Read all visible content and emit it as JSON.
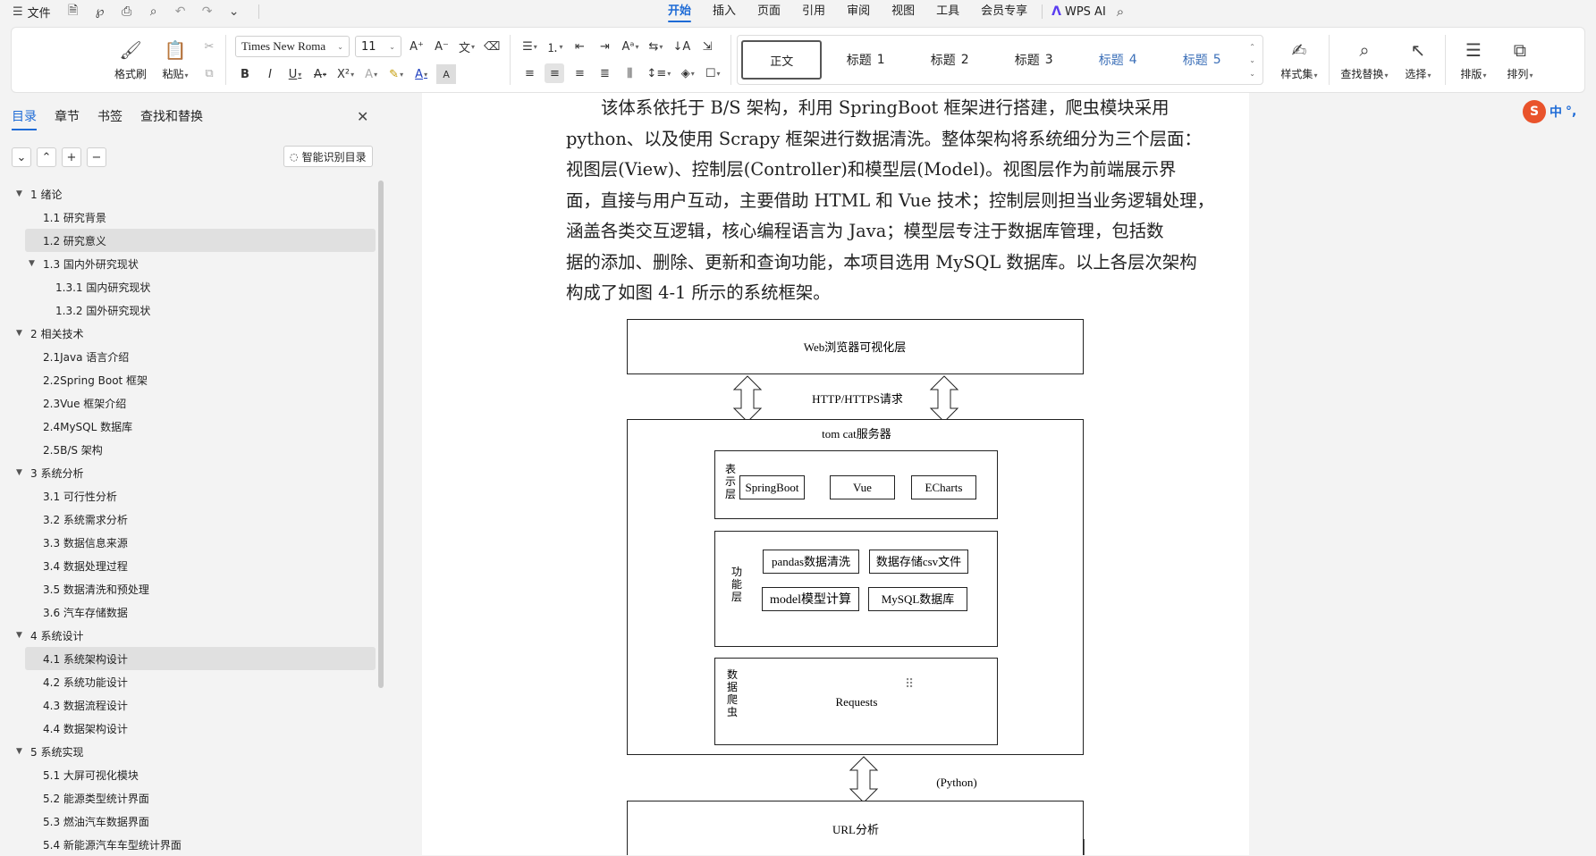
{
  "menubar": {
    "file_label": "文件",
    "tabs": [
      {
        "label": "开始",
        "active": true
      },
      {
        "label": "插入"
      },
      {
        "label": "页面"
      },
      {
        "label": "引用"
      },
      {
        "label": "审阅"
      },
      {
        "label": "视图"
      },
      {
        "label": "工具"
      },
      {
        "label": "会员专享"
      }
    ],
    "wps_ai_label": "WPS AI"
  },
  "ribbon": {
    "format_painter": "格式刷",
    "paste": "粘贴",
    "font_name": "Times New Roma",
    "font_size": "11",
    "styles": [
      {
        "label": "正文",
        "selected": true
      },
      {
        "label": "标题",
        "num": "1"
      },
      {
        "label": "标题",
        "num": "2"
      },
      {
        "label": "标题",
        "num": "3"
      },
      {
        "label": "标题",
        "num": "4",
        "blue": true
      },
      {
        "label": "标题",
        "num": "5",
        "blue": true
      }
    ],
    "style_set": "样式集",
    "find_replace": "查找替换",
    "select": "选择",
    "layout": "排版",
    "arrange": "排列"
  },
  "panel": {
    "tabs": [
      {
        "label": "目录",
        "active": true
      },
      {
        "label": "章节"
      },
      {
        "label": "书签"
      },
      {
        "label": "查找和替换"
      }
    ],
    "smart_toc": "智能识别目录",
    "toc": [
      {
        "label": "1 绪论",
        "level": 1,
        "expanded": true
      },
      {
        "label": "1.1 研究背景",
        "level": 2
      },
      {
        "label": "1.2 研究意义",
        "level": 2,
        "selected": true
      },
      {
        "label": "1.3 国内外研究现状",
        "level": 2,
        "expanded": true
      },
      {
        "label": "1.3.1 国内研究现状",
        "level": 3
      },
      {
        "label": "1.3.2 国外研究现状",
        "level": 3
      },
      {
        "label": "2 相关技术",
        "level": 1,
        "expanded": true
      },
      {
        "label": "2.1Java 语言介绍",
        "level": 2
      },
      {
        "label": "2.2Spring Boot 框架",
        "level": 2
      },
      {
        "label": "2.3Vue 框架介绍",
        "level": 2
      },
      {
        "label": "2.4MySQL 数据库",
        "level": 2
      },
      {
        "label": "2.5B/S 架构",
        "level": 2
      },
      {
        "label": "3 系统分析",
        "level": 1,
        "expanded": true
      },
      {
        "label": "3.1 可行性分析",
        "level": 2
      },
      {
        "label": "3.2 系统需求分析",
        "level": 2
      },
      {
        "label": "3.3 数据信息来源",
        "level": 2
      },
      {
        "label": "3.4 数据处理过程",
        "level": 2
      },
      {
        "label": "3.5 数据清洗和预处理",
        "level": 2
      },
      {
        "label": "3.6 汽车存储数据",
        "level": 2
      },
      {
        "label": "4 系统设计",
        "level": 1,
        "expanded": true
      },
      {
        "label": "4.1 系统架构设计",
        "level": 2,
        "selected": true
      },
      {
        "label": "4.2 系统功能设计",
        "level": 2
      },
      {
        "label": "4.3 数据流程设计",
        "level": 2
      },
      {
        "label": "4.4 数据架构设计",
        "level": 2
      },
      {
        "label": "5 系统实现",
        "level": 1,
        "expanded": true
      },
      {
        "label": "5.1  大屏可视化模块",
        "level": 2
      },
      {
        "label": "5.2 能源类型统计界面",
        "level": 2
      },
      {
        "label": "5.3 燃油汽车数据界面",
        "level": 2
      },
      {
        "label": "5.4 新能源汽车车型统计界面",
        "level": 2
      }
    ]
  },
  "doc": {
    "paragraph_lines": [
      "该体系依托于 B/S 架构，利用 SpringBoot 框架进行搭建，爬虫模块采用",
      "python、以及使用 Scrapy 框架进行数据清洗。整体架构将系统细分为三个层面：",
      "视图层(View)、控制层(Controller)和模型层(Model)。视图层作为前端展示界",
      "面，直接与用户互动，主要借助 HTML 和 Vue 技术；控制层则担当业务逻辑处理，",
      "涵盖各类交互逻辑，核心编程语言为 Java；模型层专注于数据库管理，包括数",
      "据的添加、删除、更新和查询功能，本项目选用 MySQL 数据库。以上各层次架构",
      "构成了如图 4-1 所示的系统框架。"
    ],
    "diagram": {
      "browser_layer": "Web浏览器可视化层",
      "http_label": "HTTP/HTTPS请求",
      "server_title": "tom cat服务器",
      "presentation_label": "表示层",
      "presentation_items": [
        "SpringBoot",
        "Vue",
        "ECharts"
      ],
      "function_label": "功能层",
      "function_items": [
        "pandas数据清洗",
        "数据存储csv文件",
        "model模型计算",
        "MySQL数据库"
      ],
      "crawler_label": "数据爬虫",
      "crawler_item": "Requests",
      "python_label": "(Python)",
      "url_label": "URL分析"
    }
  },
  "ime": {
    "label": "中"
  }
}
